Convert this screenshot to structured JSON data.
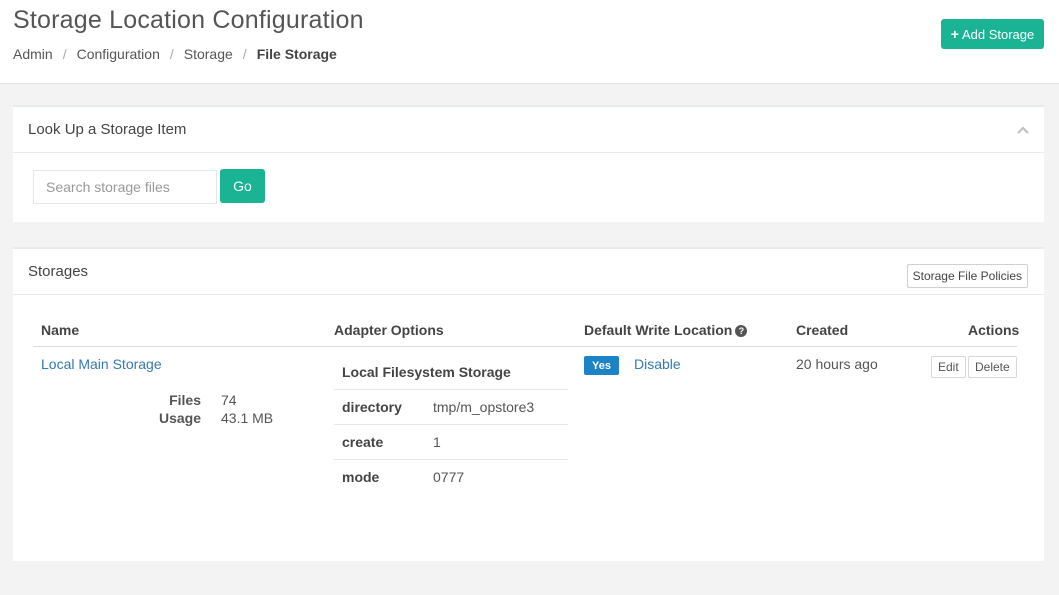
{
  "header": {
    "title": "Storage Location Configuration",
    "breadcrumb": [
      "Admin",
      "Configuration",
      "Storage",
      "File Storage"
    ],
    "add_button_icon": "+",
    "add_button_label": "Add Storage"
  },
  "lookup": {
    "title": "Look Up a Storage Item",
    "search_placeholder": "Search storage files",
    "go_label": "Go"
  },
  "storages": {
    "title": "Storages",
    "policies_label": "Storage File Policies",
    "columns": {
      "name": "Name",
      "adapter": "Adapter Options",
      "default_write": "Default Write Location",
      "created": "Created",
      "actions": "Actions"
    },
    "rows": [
      {
        "name": "Local Main Storage",
        "files_label": "Files",
        "files": "74",
        "usage_label": "Usage",
        "usage": "43.1 MB",
        "adapter_title": "Local Filesystem Storage",
        "options": [
          {
            "key": "directory",
            "value": "tmp/m_opstore3"
          },
          {
            "key": "create",
            "value": "1"
          },
          {
            "key": "mode",
            "value": "0777"
          }
        ],
        "default_write": "Yes",
        "disable_label": "Disable",
        "created": "20 hours ago",
        "edit_label": "Edit",
        "delete_label": "Delete"
      }
    ]
  },
  "colors": {
    "primary": "#1ab394",
    "info": "#1c84c6",
    "link": "#337ab7"
  }
}
